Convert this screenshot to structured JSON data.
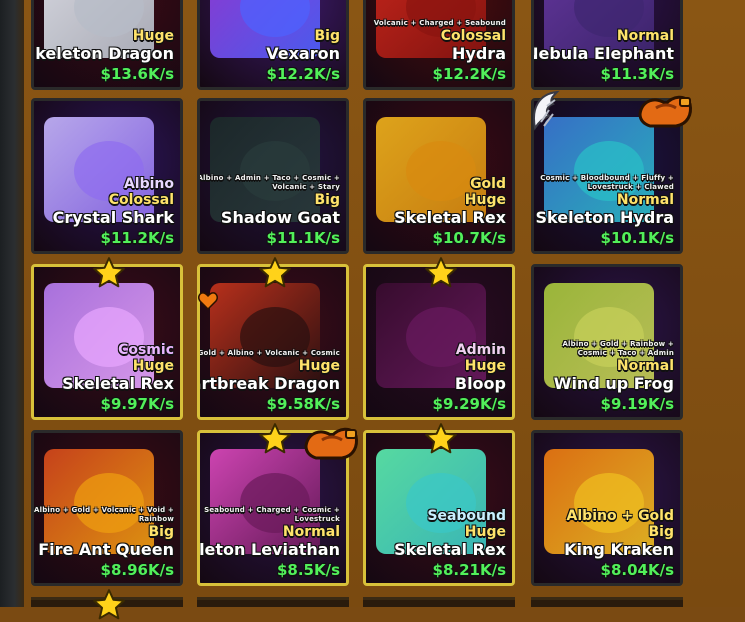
{
  "cards": [
    {
      "mutations": "",
      "mut2": "",
      "variant": "",
      "rarity": "Huge",
      "name": "Skeleton Dragon",
      "rate": "$13.6K/s",
      "variant_color": "",
      "bg": "#3a0a14",
      "art": "#e9edf5",
      "art2": "#b6bcc7",
      "featured": false
    },
    {
      "mutations": "",
      "mut2": "",
      "variant": "",
      "rarity": "Big",
      "name": "Vexaron",
      "rate": "$12.2K/s",
      "variant_color": "",
      "bg": "#3c1a6a",
      "art": "#9a3ce0",
      "art2": "#4d62ff",
      "featured": false
    },
    {
      "mutations": "Volcanic + Charged + Seabound",
      "mut2": "",
      "variant": "",
      "rarity": "Colossal",
      "name": "Hydra",
      "rate": "$12.2K/s",
      "variant_color": "",
      "bg": "#4a0c0c",
      "art": "#d4281c",
      "art2": "#8a1410",
      "featured": false
    },
    {
      "mutations": "",
      "mut2": "",
      "variant": "",
      "rarity": "Normal",
      "name": "Nebula Elephant",
      "rate": "$11.3K/s",
      "variant_color": "",
      "bg": "#2a1248",
      "art": "#6a3aa8",
      "art2": "#3e2670",
      "featured": false
    },
    {
      "mutations": "",
      "mut2": "",
      "variant": "Albino",
      "rarity": "Colossal",
      "name": "Crystal Shark",
      "rate": "$11.2K/s",
      "variant_color": "#e8d8ff",
      "bg": "#2a1456",
      "art": "#c8b8ff",
      "art2": "#8e6cf0",
      "featured": false
    },
    {
      "mutations": "Albino + Admin + Taco + Cosmic +",
      "mut2": "Volcanic + Stary",
      "variant": "",
      "rarity": "Big",
      "name": "Shadow Goat",
      "rate": "$11.1K/s",
      "variant_color": "",
      "bg": "#221440",
      "art": "#1c2a2a",
      "art2": "#2a3c3c",
      "featured": false
    },
    {
      "mutations": "",
      "mut2": "",
      "variant": "Gold",
      "rarity": "Huge",
      "name": "Skeletal Rex",
      "rate": "$10.7K/s",
      "variant_color": "#ffe36b",
      "bg": "#3a0a14",
      "art": "#f2b41c",
      "art2": "#d88a10",
      "featured": false
    },
    {
      "mutations": "Cosmic + Bloodbound + Fluffy +",
      "mut2": "Lovestruck + Clawed",
      "variant": "",
      "rarity": "Normal",
      "name": "Skeleton Hydra",
      "rate": "$10.1K/s",
      "variant_color": "",
      "bg": "#1a1240",
      "art": "#3a7ad8",
      "art2": "#2ac0c8",
      "featured": false
    },
    {
      "mutations": "",
      "mut2": "",
      "variant": "Cosmic",
      "rarity": "Huge",
      "name": "Skeletal Rex",
      "rate": "$9.97K/s",
      "variant_color": "#e9b6ff",
      "bg": "#3a0c18",
      "art": "#b77cf2",
      "art2": "#e8a6ff",
      "featured": true
    },
    {
      "mutations": "Gold + Albino + Volcanic + Cosmic",
      "mut2": "",
      "variant": "",
      "rarity": "Huge",
      "name": "Heartbreak Dragon",
      "rate": "$9.58K/s",
      "variant_color": "",
      "bg": "#3a0c18",
      "art": "#c8341c",
      "art2": "#2a1010",
      "featured": true
    },
    {
      "mutations": "",
      "mut2": "",
      "variant": "Admin",
      "rarity": "Huge",
      "name": "Bloop",
      "rate": "$9.29K/s",
      "variant_color": "#f0d0f0",
      "bg": "#2a0c22",
      "art": "#3a0c30",
      "art2": "#6a1a60",
      "featured": true
    },
    {
      "mutations": "Albino + Gold + Rainbow +",
      "mut2": "Cosmic + Taco + Admin",
      "variant": "",
      "rarity": "Normal",
      "name": "Wind up Frog",
      "rate": "$9.19K/s",
      "variant_color": "",
      "bg": "#2a1446",
      "art": "#a8c83c",
      "art2": "#c8d05a",
      "featured": false
    },
    {
      "mutations": "Albino + Gold + Volcanic + Void +",
      "mut2": "Rainbow",
      "variant": "",
      "rarity": "Big",
      "name": "Fire Ant Queen",
      "rate": "$8.96K/s",
      "variant_color": "",
      "bg": "#3a0c14",
      "art": "#d8481c",
      "art2": "#f0a010",
      "featured": false
    },
    {
      "mutations": "Seabound + Charged + Cosmic +",
      "mut2": "Lovestruck",
      "variant": "",
      "rarity": "Normal",
      "name": "Skeleton Leviathan",
      "rate": "$8.5K/s",
      "variant_color": "",
      "bg": "#2a1446",
      "art": "#e04ac0",
      "art2": "#6a1a5a",
      "featured": true
    },
    {
      "mutations": "",
      "mut2": "",
      "variant": "Seabound",
      "rarity": "Huge",
      "name": "Skeletal Rex",
      "rate": "$8.21K/s",
      "variant_color": "#c8f0ff",
      "bg": "#3a0c18",
      "art": "#5cf0b0",
      "art2": "#3ac8c8",
      "featured": true
    },
    {
      "mutations": "",
      "mut2": "",
      "variant": "Albino + Gold",
      "rarity": "Big",
      "name": "King Kraken",
      "rate": "$8.04K/s",
      "variant_color": "#ffe36b",
      "bg": "#2a1446",
      "art": "#f07a10",
      "art2": "#f0c020",
      "featured": false
    }
  ],
  "colors": {
    "accent": "#ffe36b",
    "rate": "#52f05a",
    "featured_border": "#d8c13a"
  }
}
